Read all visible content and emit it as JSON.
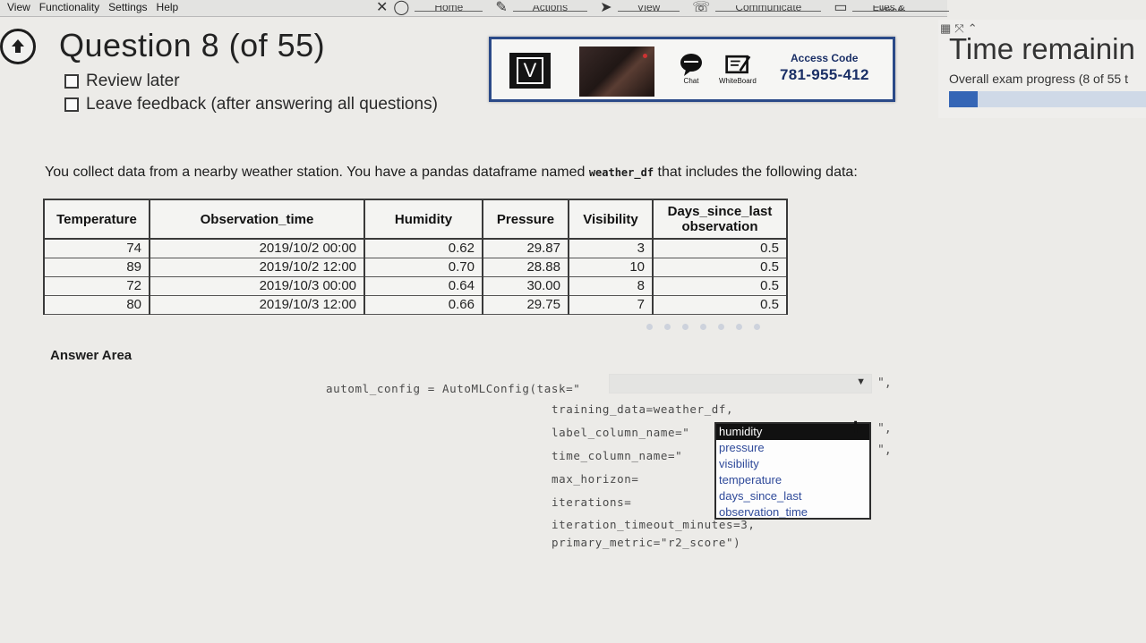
{
  "menu": [
    "View",
    "Functionality",
    "Settings",
    "Help"
  ],
  "toolbar": [
    "Home",
    "Actions",
    "View",
    "Communicate",
    "Files & Extras"
  ],
  "question": {
    "title": "Question 8 (of 55)",
    "review_later": "Review later",
    "leave_feedback": "Leave feedback (after answering all questions)"
  },
  "proctor": {
    "v_button": "V",
    "chat_label": "Chat",
    "whiteboard_label": "WhiteBoard",
    "access_code_label": "Access Code",
    "access_code": "781-955-412"
  },
  "timer": {
    "title": "Time remainin",
    "progress_text": "Overall exam progress (8 of 55 t",
    "progress_fraction": 0.145
  },
  "intro": {
    "before": "You collect data from a nearby weather station. You have a pandas dataframe named ",
    "code": "weather_df",
    "after": " that includes the following data:"
  },
  "table": {
    "headers": [
      "Temperature",
      "Observation_time",
      "Humidity",
      "Pressure",
      "Visibility",
      "Days_since_last observation"
    ],
    "rows": [
      [
        "74",
        "2019/10/2 00:00",
        "0.62",
        "29.87",
        "3",
        "0.5"
      ],
      [
        "89",
        "2019/10/2 12:00",
        "0.70",
        "28.88",
        "10",
        "0.5"
      ],
      [
        "72",
        "2019/10/3 00:00",
        "0.64",
        "30.00",
        "8",
        "0.5"
      ],
      [
        "80",
        "2019/10/3 12:00",
        "0.66",
        "29.75",
        "7",
        "0.5"
      ]
    ]
  },
  "answer": {
    "label": "Answer Area",
    "code_line1": "automl_config = AutoMLConfig(task=\"",
    "code_training": "training_data=weather_df,",
    "code_label": "label_column_name=\"",
    "code_time": "time_column_name=\"",
    "code_horizon": "max_horizon=",
    "code_iterations": "iterations=",
    "code_timeout": "iteration_timeout_minutes=3,",
    "code_metric": "primary_metric=\"r2_score\")",
    "tail": "\",",
    "options": [
      "humidity",
      "pressure",
      "visibility",
      "temperature",
      "days_since_last",
      "observation_time"
    ],
    "selected_index": 0
  }
}
